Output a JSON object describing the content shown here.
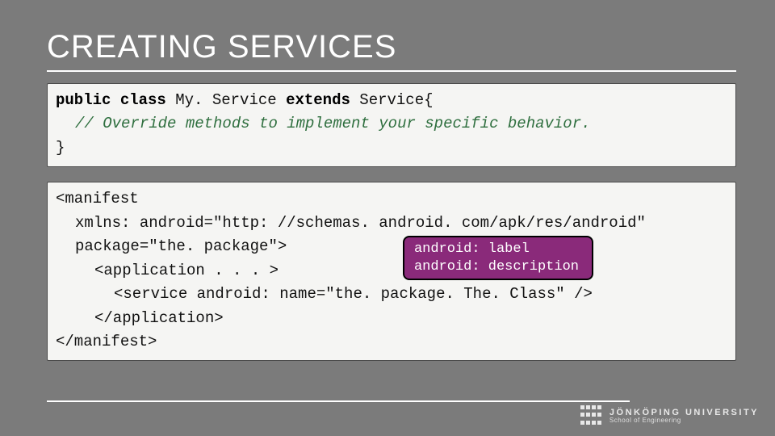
{
  "title": "CREATING SERVICES",
  "code1": {
    "l1a": "public class",
    "l1b": " My. Service ",
    "l1c": "extends",
    "l1d": " Service{",
    "l2": "// Override methods to implement your specific behavior.",
    "l3": "}"
  },
  "code2": {
    "l1": "<manifest",
    "l2": "xmlns: android=\"http: //schemas. android. com/apk/res/android\"",
    "l3": "package=\"the. package\">",
    "l4": "<application . . . >",
    "l5": "<service android: name=\"the. package. The. Class\" />",
    "l6": "</application>",
    "l7": "</manifest>"
  },
  "callout": {
    "l1": "android: label",
    "l2": "android: description"
  },
  "footer": {
    "university": "JÖNKÖPING UNIVERSITY",
    "school": "School of Engineering"
  }
}
